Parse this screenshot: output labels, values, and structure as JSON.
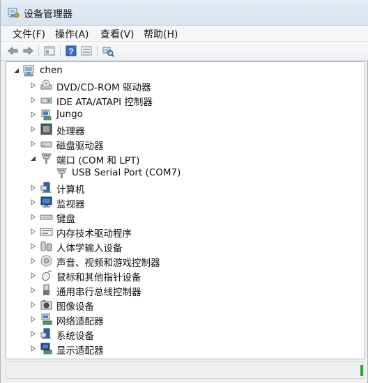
{
  "window": {
    "title": "设备管理器"
  },
  "menu": {
    "file": "文件(F)",
    "action": "操作(A)",
    "view": "查看(V)",
    "help": "帮助(H)"
  },
  "toolbar": {
    "icons": [
      "back-arrow-icon",
      "forward-arrow-icon",
      "properties-icon",
      "help-icon",
      "view-pane-icon",
      "scan-hardware-icon"
    ]
  },
  "tree": {
    "root": {
      "label": "chen",
      "expanded": true
    },
    "items": [
      {
        "label": "DVD/CD-ROM 驱动器",
        "icon": "dvd-drive-icon",
        "expanded": false
      },
      {
        "label": "IDE ATA/ATAPI 控制器",
        "icon": "ide-controller-icon",
        "expanded": false
      },
      {
        "label": "Jungo",
        "icon": "jungo-icon",
        "expanded": false
      },
      {
        "label": "处理器",
        "icon": "processor-icon",
        "expanded": false
      },
      {
        "label": "磁盘驱动器",
        "icon": "disk-drive-icon",
        "expanded": false
      },
      {
        "label": "端口 (COM 和 LPT)",
        "icon": "port-icon",
        "expanded": true,
        "children": [
          {
            "label": "USB Serial Port (COM7)",
            "icon": "port-icon"
          }
        ]
      },
      {
        "label": "计算机",
        "icon": "computer-icon",
        "expanded": false
      },
      {
        "label": "监视器",
        "icon": "monitor-icon",
        "expanded": false
      },
      {
        "label": "键盘",
        "icon": "keyboard-icon",
        "expanded": false
      },
      {
        "label": "内存技术驱动程序",
        "icon": "memory-tech-icon",
        "expanded": false
      },
      {
        "label": "人体学输入设备",
        "icon": "hid-icon",
        "expanded": false
      },
      {
        "label": "声音、视频和游戏控制器",
        "icon": "sound-icon",
        "expanded": false
      },
      {
        "label": "鼠标和其他指针设备",
        "icon": "mouse-icon",
        "expanded": false
      },
      {
        "label": "通用串行总线控制器",
        "icon": "usb-icon",
        "expanded": false
      },
      {
        "label": "图像设备",
        "icon": "camera-icon",
        "expanded": false
      },
      {
        "label": "网络适配器",
        "icon": "network-icon",
        "expanded": false
      },
      {
        "label": "系统设备",
        "icon": "system-device-icon",
        "expanded": false
      },
      {
        "label": "显示适配器",
        "icon": "display-adapter-icon",
        "expanded": false
      }
    ]
  },
  "status": {
    "text": ""
  }
}
